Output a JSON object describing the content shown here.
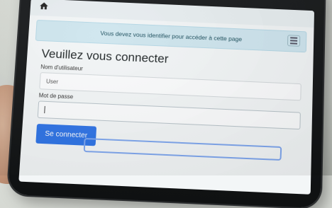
{
  "alert": {
    "message": "Vous devez vous identifier pour accéder à cette page"
  },
  "login": {
    "heading": "Veuillez vous connecter",
    "username_label": "Nom d'utilisateur",
    "username_value": "User",
    "password_label": "Mot de passe",
    "password_value": "",
    "submit_label": "Se connecter"
  },
  "icons": {
    "home": "home-icon",
    "menu": "hamburger-menu-icon"
  },
  "colors": {
    "primary_button": "#2e73e6",
    "alert_bg": "#cfe6ef",
    "device_frame": "#141617"
  }
}
